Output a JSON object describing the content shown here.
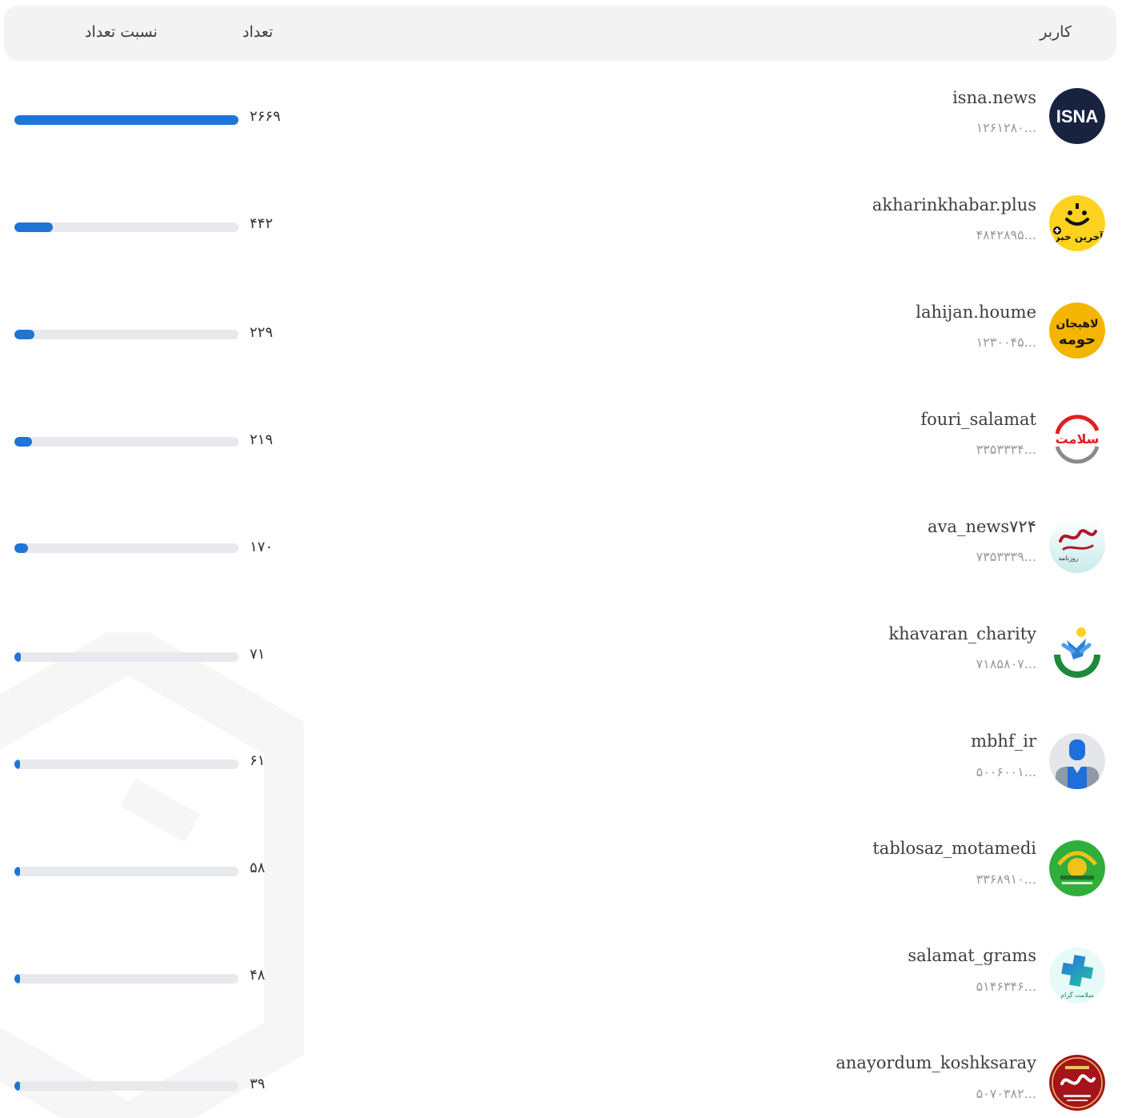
{
  "header": {
    "user_label": "کاربر",
    "count_label": "تعداد",
    "ratio_label": "نسبت تعداد"
  },
  "rows": [
    {
      "username": "isna.news",
      "user_id": "۱۲۶۱۲۸۰...",
      "count": "۲۶۶۹",
      "ratio": 1.0,
      "avatar": "isna-logo"
    },
    {
      "username": "akharinkhabar.plus",
      "user_id": "۴۸۴۲۸۹۵...",
      "count": "۴۴۲",
      "ratio": 0.17,
      "avatar": "akharinkhabar-logo"
    },
    {
      "username": "lahijan.houme",
      "user_id": "۱۲۳۰۰۴۵...",
      "count": "۲۲۹",
      "ratio": 0.09,
      "avatar": "lahijan-logo"
    },
    {
      "username": "fouri_salamat",
      "user_id": "۳۳۵۳۳۳۴...",
      "count": "۲۱۹",
      "ratio": 0.08,
      "avatar": "salamat-logo"
    },
    {
      "username": "ava_news۷۲۴",
      "user_id": "۷۳۵۳۳۳۹...",
      "count": "۱۷۰",
      "ratio": 0.06,
      "avatar": "ava-logo"
    },
    {
      "username": "khavaran_charity",
      "user_id": "۷۱۸۵۸۰۷...",
      "count": "۷۱",
      "ratio": 0.03,
      "avatar": "khavaran-logo"
    },
    {
      "username": "mbhf_ir",
      "user_id": "۵۰۰۶۰۰۱...",
      "count": "۶۱",
      "ratio": 0.02,
      "avatar": "default-user"
    },
    {
      "username": "tablosaz_motamedi",
      "user_id": "۳۳۶۸۹۱۰...",
      "count": "۵۸",
      "ratio": 0.02,
      "avatar": "tablosaz-logo"
    },
    {
      "username": "salamat_grams",
      "user_id": "۵۱۴۶۳۴۶...",
      "count": "۴۸",
      "ratio": 0.02,
      "avatar": "salamatgram-logo"
    },
    {
      "username": "anayordum_koshksaray",
      "user_id": "۵۰۷۰۳۸۲...",
      "count": "۳۹",
      "ratio": 0.015,
      "avatar": "anayordum-logo"
    }
  ],
  "logos": {
    "isna": "ISNA",
    "akharinkhabar": "آخرین خبر",
    "lahijan_top": "لاهیجان",
    "lahijan_bottom": "حومه",
    "salamat": "سلامت",
    "ava": "روزنامه",
    "salamatgram": "سلامت گرام"
  },
  "colors": {
    "accent": "#1f74d6",
    "track": "#e8e9ec",
    "header_bg": "#f3f3f4"
  }
}
